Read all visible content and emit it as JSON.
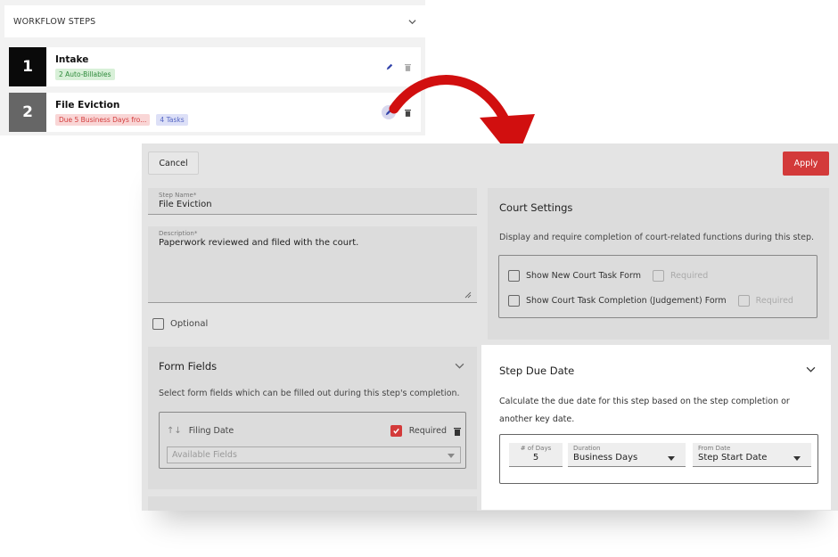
{
  "workflow": {
    "header_title": "WORKFLOW STEPS",
    "steps": [
      {
        "number": "1",
        "name": "Intake",
        "badges": [
          "2 Auto-Billables"
        ]
      },
      {
        "number": "2",
        "name": "File Eviction",
        "badges": [
          "Due 5 Business Days fro...",
          "4 Tasks"
        ]
      }
    ]
  },
  "toolbar": {
    "cancel_label": "Cancel",
    "apply_label": "Apply"
  },
  "step_name": {
    "label": "Step Name*",
    "value": "File Eviction"
  },
  "description": {
    "label": "Description*",
    "value": "Paperwork reviewed and filed with the court."
  },
  "optional_label": "Optional",
  "court_settings": {
    "title": "Court Settings",
    "description": "Display and require completion of court-related functions during this step.",
    "options": [
      {
        "label": "Show New Court Task Form",
        "required_label": "Required"
      },
      {
        "label": "Show Court Task Completion (Judgement) Form",
        "required_label": "Required"
      }
    ]
  },
  "form_fields": {
    "title": "Form Fields",
    "description": "Select form fields which can be filled out during this step's completion.",
    "row": {
      "sort_glyph": "↑↓",
      "name": "Filing Date",
      "required_label": "Required"
    },
    "select_placeholder": "Available Fields"
  },
  "due_date": {
    "title": "Step Due Date",
    "description": "Calculate the due date for this step based on the step completion or another key date.",
    "fields": [
      {
        "label": "# of Days",
        "value": "5"
      },
      {
        "label": "Duration",
        "value": "Business Days"
      },
      {
        "label": "From Date",
        "value": "Step Start Date"
      }
    ]
  },
  "colors": {
    "accent": "#d33a3a",
    "arrow": "#d10f0f"
  }
}
